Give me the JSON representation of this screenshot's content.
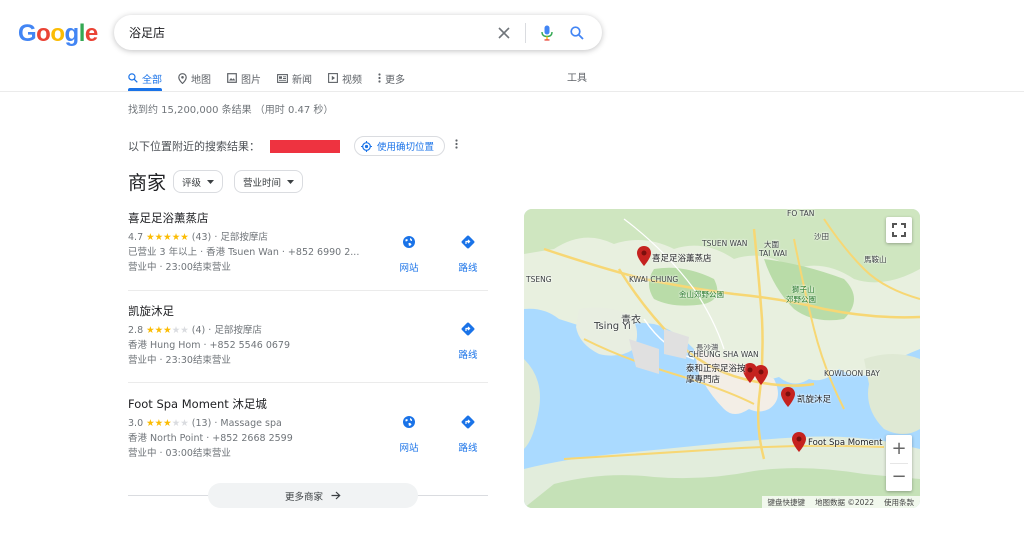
{
  "logo": {
    "letters": [
      "G",
      "o",
      "o",
      "g",
      "l",
      "e"
    ],
    "colors": [
      "#4285F4",
      "#EA4335",
      "#FBBC05",
      "#4285F4",
      "#34A853",
      "#EA4335"
    ]
  },
  "search": {
    "query": "浴足店"
  },
  "tabs": [
    {
      "label": "全部",
      "icon": "search-icon",
      "active": true
    },
    {
      "label": "地图",
      "icon": "map-pin-icon"
    },
    {
      "label": "图片",
      "icon": "image-icon"
    },
    {
      "label": "新闻",
      "icon": "news-icon"
    },
    {
      "label": "视频",
      "icon": "video-icon"
    },
    {
      "label": "更多",
      "icon": "more-vert-icon"
    }
  ],
  "tools_label": "工具",
  "stats": "找到约 15,200,000 条结果 （用时 0.47 秒）",
  "location": {
    "prefix": "以下位置附近的搜索结果：",
    "precise_label": "使用确切位置"
  },
  "businesses": {
    "title": "商家",
    "filters": [
      "评级",
      "营业时间"
    ],
    "listings": [
      {
        "name": "喜足足浴薰蒸店",
        "rating": "4.7",
        "stars": 5,
        "reviews": "(43)",
        "category": "· 足部按摩店",
        "line2": "已营业 3 年以上 · 香港 Tsuen Wan · +852 6990 2...",
        "hours": "营业中 · 23:00结束营业",
        "website_label": "网站",
        "directions_label": "路线"
      },
      {
        "name": "凯旋沐足",
        "rating": "2.8",
        "stars": 3,
        "reviews": "(4)",
        "category": "· 足部按摩店",
        "line2": "香港 Hung Hom · +852 5546 0679",
        "hours": "营业中 · 23:30结束营业",
        "directions_label": "路线"
      },
      {
        "name": "Foot Spa Moment 沐足城",
        "rating": "3.0",
        "stars": 3,
        "reviews": "(13)",
        "category": "· Massage spa",
        "line2": "香港 North Point · +852 2668 2599",
        "hours": "营业中 · 03:00结束营业",
        "website_label": "网站",
        "directions_label": "路线"
      }
    ],
    "more_label": "更多商家"
  },
  "map": {
    "pins": [
      "喜足足浴薰蒸店",
      "泰和正宗足浴按摩專門店",
      "凯旋沐足",
      "Foot Spa Moment"
    ],
    "labels": {
      "kwai_chung": "KWAI CHUNG",
      "tsing_yi_cn": "青衣",
      "tsing_yi": "Tsing Yi",
      "kam_shan": "金山郊野公園",
      "lion_rock_cn": "獅子山",
      "lion_rock": "郊野公園",
      "tai_wai_cn": "大圍",
      "tai_wai": "TAI WAI",
      "sha_tin": "沙田",
      "fo_tan": "FO TAN",
      "cheung_sha_wan_cn": "長沙灣",
      "cheung_sha_wan": "CHEUNG SHA WAN",
      "kowloon_bay": "KOWLOON BAY",
      "tsuen_wan": "TSUEN WAN",
      "tseng": "TSENG",
      "ma_on": "馬鞍山"
    },
    "attribution": [
      "键盘快捷键",
      "地图数据 ©2022",
      "使用条款"
    ]
  }
}
